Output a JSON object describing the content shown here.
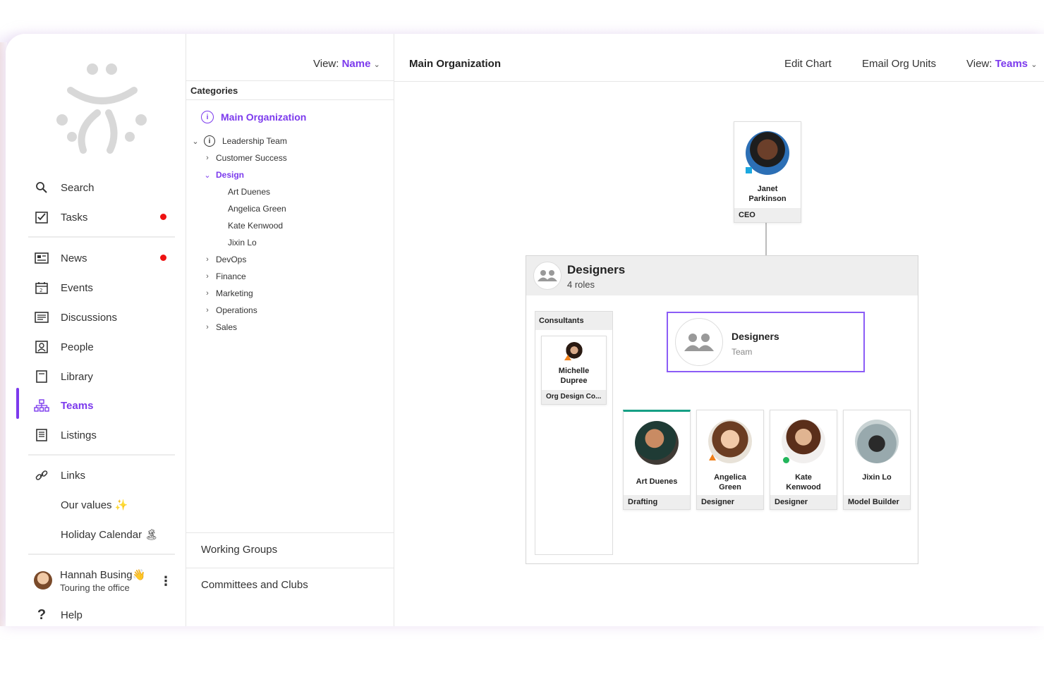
{
  "sidebar": {
    "items": [
      {
        "label": "Search",
        "icon": "search-icon"
      },
      {
        "label": "Tasks",
        "icon": "tasks-icon"
      },
      {
        "label": "News",
        "icon": "news-icon"
      },
      {
        "label": "Events",
        "icon": "calendar-icon"
      },
      {
        "label": "Discussions",
        "icon": "discussions-icon"
      },
      {
        "label": "People",
        "icon": "people-icon"
      },
      {
        "label": "Library",
        "icon": "library-icon"
      },
      {
        "label": "Teams",
        "icon": "teams-icon"
      },
      {
        "label": "Listings",
        "icon": "listings-icon"
      },
      {
        "label": "Links",
        "icon": "link-icon"
      },
      {
        "label": "Our values ✨"
      },
      {
        "label": "Holiday Calendar 🏝"
      }
    ],
    "user": {
      "name": "Hannah Busing👋",
      "status": "Touring the office"
    },
    "help": "Help",
    "active_color": "#7c3aed",
    "badge_color": "#e11111"
  },
  "categories": {
    "view_label": "View:",
    "view_value": "Name",
    "header": "Categories",
    "root": "Main Organization",
    "tree": [
      {
        "label": "Leadership Team"
      },
      {
        "label": "Customer Success"
      },
      {
        "label": "Design"
      },
      {
        "label": "Art Duenes"
      },
      {
        "label": "Angelica Green"
      },
      {
        "label": "Kate Kenwood"
      },
      {
        "label": "Jixin Lo"
      },
      {
        "label": "DevOps"
      },
      {
        "label": "Finance"
      },
      {
        "label": "Marketing"
      },
      {
        "label": "Operations"
      },
      {
        "label": "Sales"
      }
    ],
    "sections": [
      "Working Groups",
      "Committees and Clubs"
    ]
  },
  "main": {
    "title": "Main Organization",
    "actions": [
      "Edit Chart",
      "Email Org Units"
    ],
    "view_label": "View:",
    "view_value": "Teams",
    "ceo": {
      "first": "Janet",
      "last": "Parkinson",
      "role": "CEO"
    },
    "group": {
      "title": "Designers",
      "sub": "4 roles"
    },
    "consultants": {
      "header": "Consultants",
      "first": "Michelle",
      "last": "Dupree",
      "role": "Org Design Co..."
    },
    "team": {
      "title": "Designers",
      "sub": "Team"
    },
    "members": [
      {
        "first": "Art Duenes",
        "last": "",
        "role": "Drafting"
      },
      {
        "first": "Angelica",
        "last": "Green",
        "role": "Designer"
      },
      {
        "first": "Kate",
        "last": "Kenwood",
        "role": "Designer"
      },
      {
        "first": "Jixin Lo",
        "last": "",
        "role": "Model Builder"
      }
    ]
  }
}
